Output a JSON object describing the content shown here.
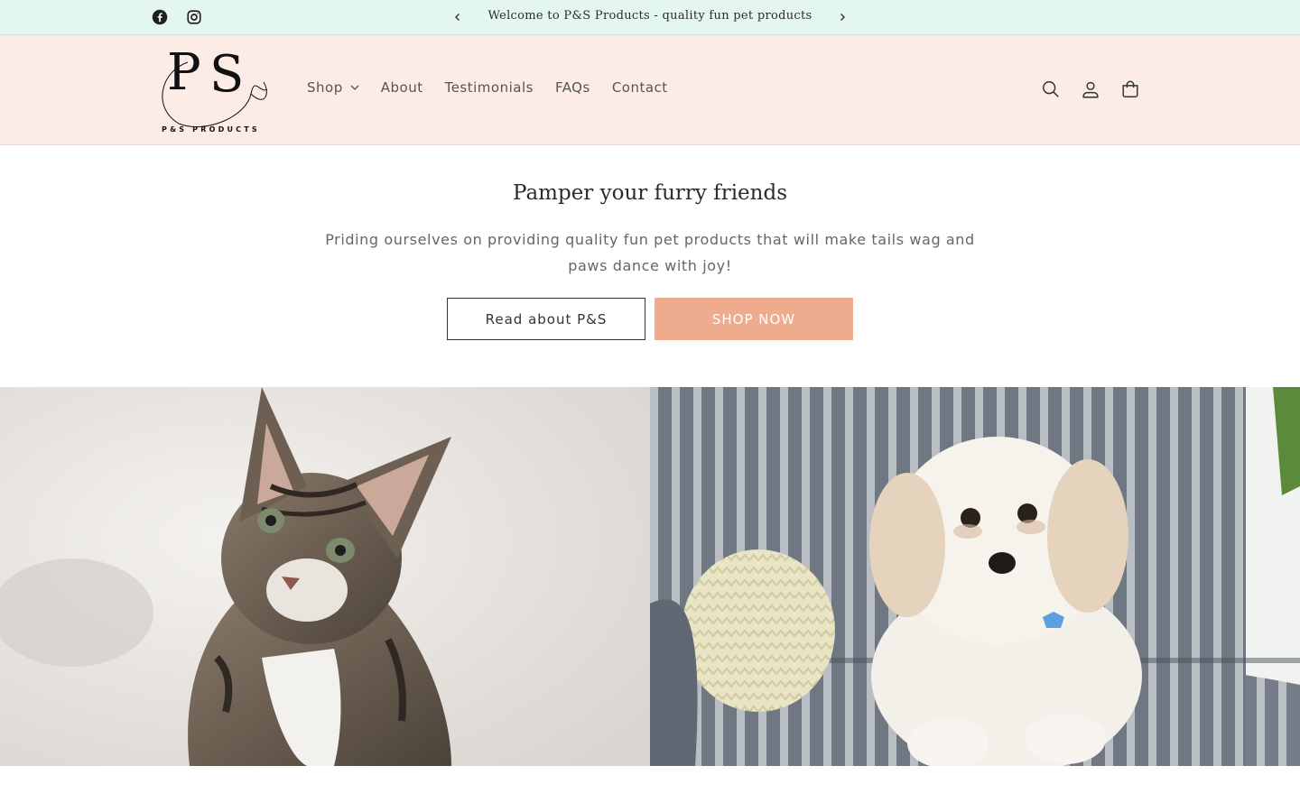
{
  "announcement": {
    "message": "Welcome to P&S Products - quality fun pet products",
    "social_icons": [
      "facebook-icon",
      "instagram-icon"
    ],
    "prev_icon": "chevron-left-icon",
    "next_icon": "chevron-right-icon"
  },
  "header": {
    "logo": {
      "monogram": "P S",
      "tagline": "P&S PRODUCTS"
    },
    "nav": [
      {
        "label": "Shop",
        "has_dropdown": true
      },
      {
        "label": "About"
      },
      {
        "label": "Testimonials"
      },
      {
        "label": "FAQs"
      },
      {
        "label": "Contact"
      }
    ],
    "icons": [
      "search-icon",
      "account-icon",
      "cart-icon"
    ]
  },
  "hero": {
    "title": "Pamper your furry friends",
    "subtitle": "Priding ourselves on providing quality fun pet products that will make tails wag and paws dance with joy!",
    "button_secondary": "Read about P&S",
    "button_primary": "SHOP NOW"
  },
  "images": [
    {
      "subject": "kitten"
    },
    {
      "subject": "dog"
    }
  ],
  "colors": {
    "announcement_bg": "#e3f7ee",
    "header_bg": "#fcece6",
    "accent": "#eeab8e",
    "text_dark": "#2b2b2b"
  }
}
